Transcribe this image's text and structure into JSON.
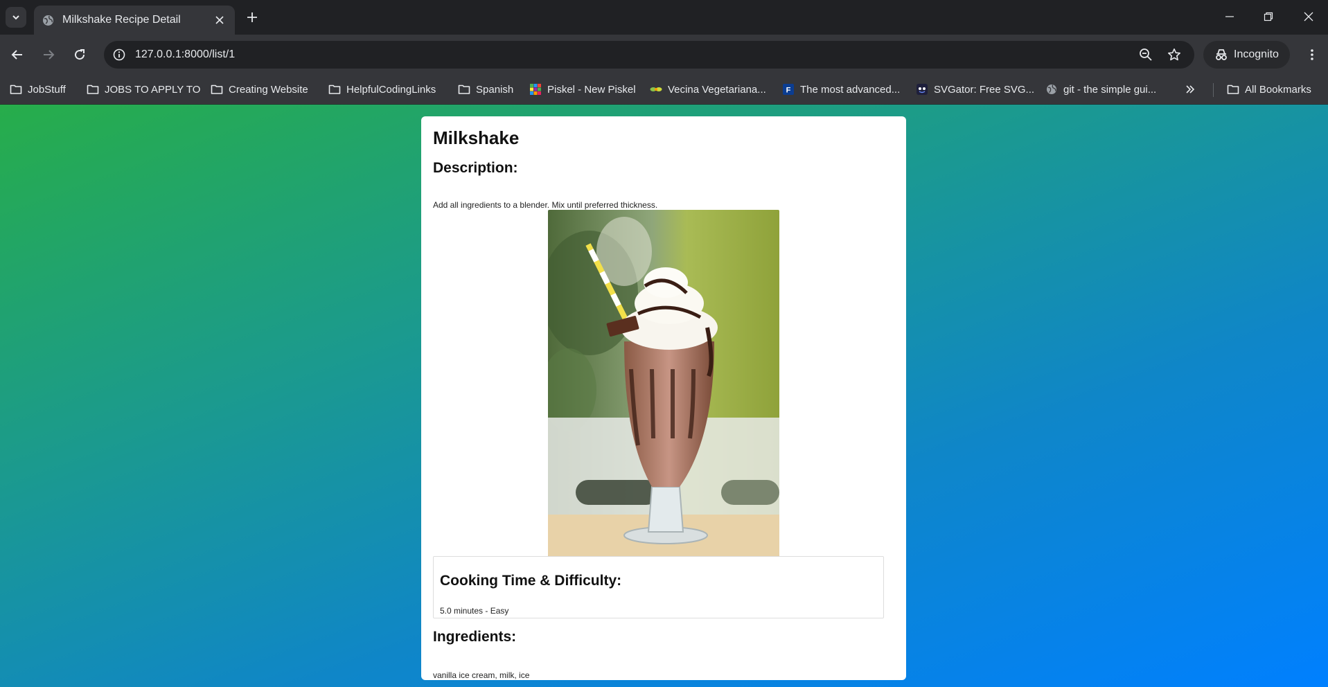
{
  "browser": {
    "tab_title": "Milkshake Recipe Detail",
    "url": "127.0.0.1:8000/list/1",
    "incognito_label": "Incognito",
    "bookmarks": [
      {
        "label": "JobStuff",
        "icon": "folder-icon"
      },
      {
        "label": "JOBS TO APPLY TO",
        "icon": "folder-icon"
      },
      {
        "label": "Creating Website",
        "icon": "folder-icon"
      },
      {
        "label": "HelpfulCodingLinks",
        "icon": "folder-icon"
      },
      {
        "label": "Spanish",
        "icon": "folder-icon"
      },
      {
        "label": "Piskel - New Piskel",
        "icon": "piskel-icon"
      },
      {
        "label": "Vecina Vegetariana...",
        "icon": "vecina-icon"
      },
      {
        "label": "The most advanced...",
        "icon": "f-icon"
      },
      {
        "label": "SVGator: Free SVG...",
        "icon": "svgator-icon"
      },
      {
        "label": "git - the simple gui...",
        "icon": "globe-icon"
      }
    ],
    "all_bookmarks_label": "All Bookmarks"
  },
  "recipe": {
    "title": "Milkshake",
    "description_heading": "Description:",
    "description": "Add all ingredients to a blender. Mix until preferred thickness.",
    "time_heading": "Cooking Time & Difficulty:",
    "time_text": "5.0 minutes - Easy",
    "ingredients_heading": "Ingredients:",
    "ingredients_text": "vanilla ice cream, milk, ice"
  }
}
